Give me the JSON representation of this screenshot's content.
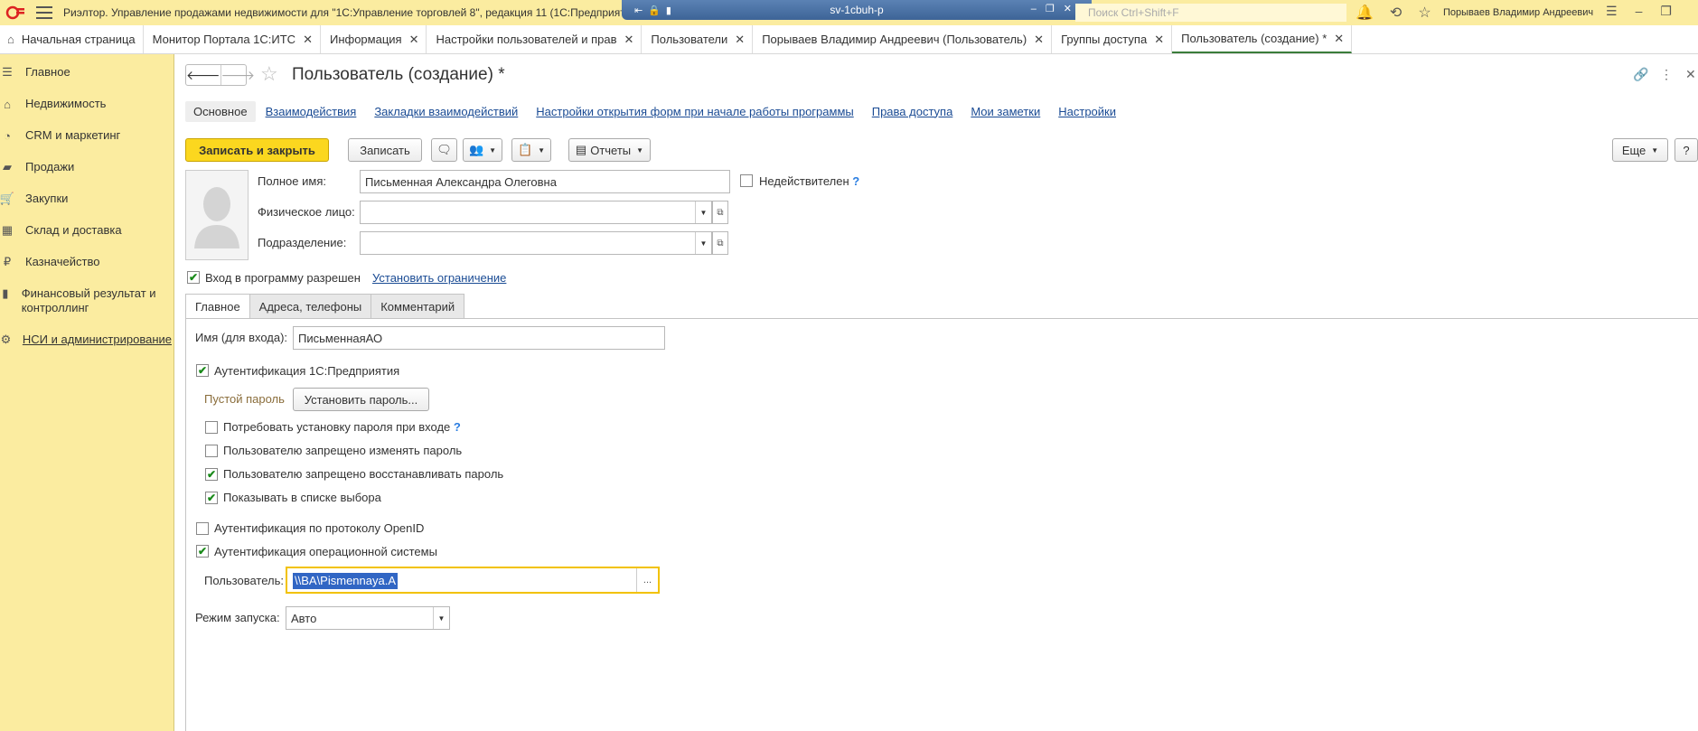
{
  "titlebar": {
    "app_title": "Риэлтор. Управление продажами недвижимости для \"1С:Управление торговлей 8\", редакция 11  (1С:Предприятие)",
    "rdp_host": "sv-1cbuh-p",
    "search_placeholder": "Поиск Ctrl+Shift+F",
    "user_name": "Порываев Владимир Андреевич"
  },
  "tabs": [
    {
      "label": "Начальная страница"
    },
    {
      "label": "Монитор Портала 1С:ИТС"
    },
    {
      "label": "Информация"
    },
    {
      "label": "Настройки пользователей и прав"
    },
    {
      "label": "Пользователи"
    },
    {
      "label": "Порываев Владимир Андреевич (Пользователь)"
    },
    {
      "label": "Группы доступа"
    },
    {
      "label": "Пользователь (создание) *"
    }
  ],
  "sidebar": {
    "items": [
      {
        "label": "Главное"
      },
      {
        "label": "Недвижимость"
      },
      {
        "label": "CRM и маркетинг"
      },
      {
        "label": "Продажи"
      },
      {
        "label": "Закупки"
      },
      {
        "label": "Склад и доставка"
      },
      {
        "label": "Казначейство"
      },
      {
        "label": "Финансовый результат и контроллинг"
      },
      {
        "label": "НСИ и администрирование"
      }
    ]
  },
  "header": {
    "title": "Пользователь (создание) *"
  },
  "sections": [
    {
      "label": "Основное"
    },
    {
      "label": "Взаимодействия"
    },
    {
      "label": "Закладки взаимодействий"
    },
    {
      "label": "Настройки открытия форм при начале работы программы"
    },
    {
      "label": "Права доступа"
    },
    {
      "label": "Мои заметки"
    },
    {
      "label": "Настройки"
    }
  ],
  "toolbar": {
    "save_close": "Записать и закрыть",
    "save": "Записать",
    "reports": "Отчеты",
    "more": "Еще",
    "help": "?"
  },
  "form": {
    "full_name_label": "Полное имя:",
    "full_name_value": "Письменная Александра Олеговна",
    "invalid_label": "Недействителен",
    "individual_label": "Физическое лицо:",
    "individual_value": "",
    "department_label": "Подразделение:",
    "department_value": "",
    "login_allowed_label": "Вход в программу разрешен",
    "set_restriction_link": "Установить ограничение"
  },
  "form_tabs": [
    {
      "label": "Главное"
    },
    {
      "label": "Адреса, телефоны"
    },
    {
      "label": "Комментарий"
    }
  ],
  "main_tab": {
    "login_name_label": "Имя (для входа):",
    "login_name_value": "ПисьменнаяАО",
    "auth_1c_label": "Аутентификация 1С:Предприятия",
    "empty_password_label": "Пустой пароль",
    "set_password_button": "Установить пароль...",
    "require_password_label": "Потребовать установку пароля при входе",
    "forbid_change_label": "Пользователю запрещено изменять пароль",
    "forbid_restore_label": "Пользователю запрещено восстанавливать пароль",
    "show_in_list_label": "Показывать в списке выбора",
    "openid_label": "Аутентификация по протоколу OpenID",
    "os_auth_label": "Аутентификация операционной системы",
    "os_user_label": "Пользователь:",
    "os_user_value": "\\\\BA\\Pismennaya.A",
    "launch_mode_label": "Режим запуска:",
    "launch_mode_value": "Авто"
  },
  "checkboxes": {
    "invalid": false,
    "login_allowed": true,
    "auth_1c": true,
    "require_password": false,
    "forbid_change": false,
    "forbid_restore": true,
    "show_in_list": true,
    "openid": false,
    "os_auth": true
  },
  "colors": {
    "sidebar_bg": "#fbeca0",
    "primary_button": "#fbd71f",
    "link": "#1a4b94",
    "check": "#1a8a1a",
    "focus_border": "#f2c200",
    "selection": "#3166c4"
  }
}
